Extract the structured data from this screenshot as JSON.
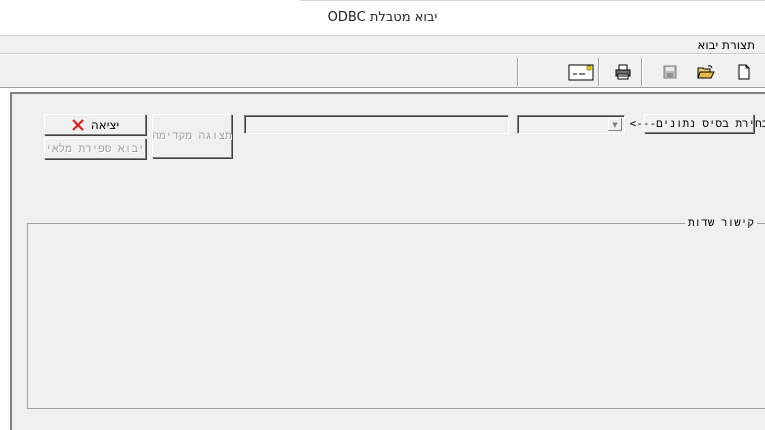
{
  "window": {
    "title": "יבוא מטבלת ODBC"
  },
  "menu": {
    "items": [
      {
        "label": "תצורת יבוא"
      }
    ]
  },
  "toolbar": {
    "icons": [
      "new-document-icon",
      "open-folder-icon",
      "save-icon",
      "print-icon",
      "envelope-icon"
    ]
  },
  "form": {
    "select_db_label": "בחירת בסיס נתונים--->",
    "table_combo_value": "",
    "table_name_value": "",
    "preview_label": "תצוגה מקדימה",
    "exit_label": "יציאה",
    "full_import_label": "יבוא ספירת מלאי"
  },
  "fields_group": {
    "label": "קישור שדות"
  },
  "colors": {
    "face": "#f0f0f0",
    "disabled_text": "#a0a0a0",
    "exit_x": "#e02020"
  }
}
